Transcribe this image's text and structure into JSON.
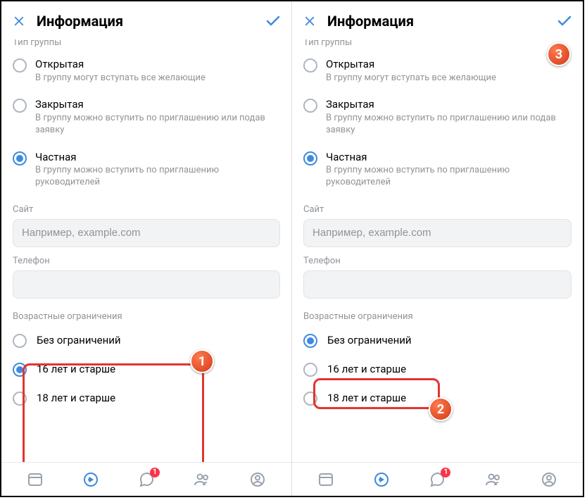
{
  "header": {
    "title": "Информация"
  },
  "group_type": {
    "label": "Тип группы",
    "options": [
      {
        "title": "Открытая",
        "desc": "В группу могут вступать все желающие"
      },
      {
        "title": "Закрытая",
        "desc": "В группу можно вступить по приглашению или подав заявку"
      },
      {
        "title": "Частная",
        "desc": "В группу можно вступить по приглашению руководителей"
      }
    ],
    "selected": 2
  },
  "site": {
    "label": "Сайт",
    "placeholder": "Например, example.com",
    "value": ""
  },
  "phone": {
    "label": "Телефон",
    "value": ""
  },
  "age": {
    "label": "Возрастные ограничения",
    "options": [
      "Без ограничений",
      "16 лет и старше",
      "18 лет и старше"
    ],
    "selected_left": 1,
    "selected_right": 0
  },
  "tabbar": {
    "msg_badge": "1"
  },
  "steps": {
    "s1": "1",
    "s2": "2",
    "s3": "3"
  }
}
